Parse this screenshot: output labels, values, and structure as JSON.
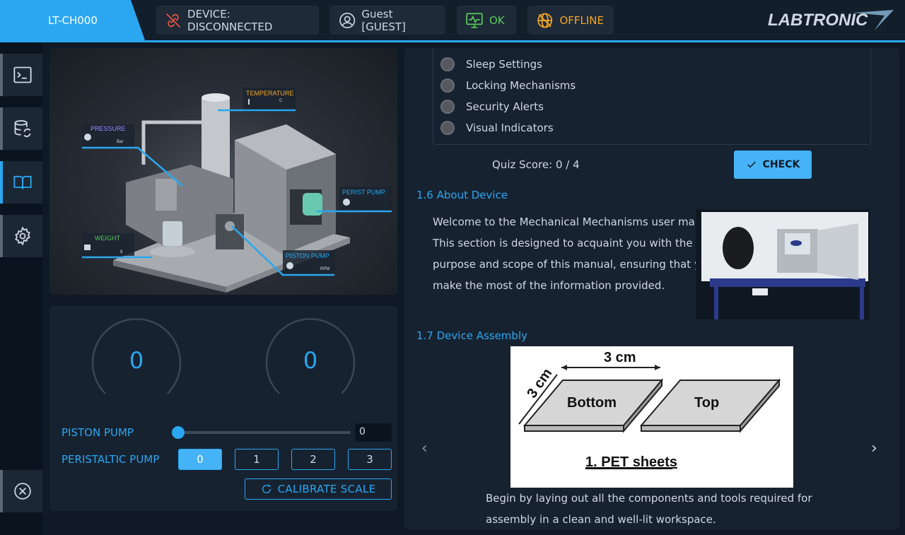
{
  "header": {
    "device_tab": "LT-CH000",
    "device_status": "DEVICE: DISCONNECTED",
    "user": "Guest [GUEST]",
    "health": "OK",
    "network": "OFFLINE",
    "logo": "LABTRONIC",
    "colors": {
      "accent": "#2aa7f0",
      "danger": "#e25545",
      "ok": "#5ac85a",
      "offline": "#f5a623"
    }
  },
  "sidebar": {
    "items": [
      {
        "icon": "terminal-icon"
      },
      {
        "icon": "database-sync-icon"
      },
      {
        "icon": "book-icon",
        "active": true
      },
      {
        "icon": "gear-icon"
      }
    ],
    "bottom": {
      "icon": "close-circle-icon"
    }
  },
  "diagram": {
    "labels": {
      "temperature": "TEMPERATURE",
      "temperature_unit": "C",
      "pressure": "PRESSURE",
      "pressure_unit": "Bar",
      "perist_pump": "PERIST PUMP",
      "weight": "WEIGHT",
      "weight_unit": "g",
      "piston_pump": "PISTON PUMP",
      "piston_unit": "RPM"
    }
  },
  "controls": {
    "gauge1": "0",
    "gauge2": "0",
    "piston_label": "PISTON PUMP",
    "piston_value": "0",
    "peristaltic_label": "PERISTALTIC PUMP",
    "peristaltic_options": [
      "0",
      "1",
      "2",
      "3"
    ],
    "peristaltic_selected": "0",
    "calibrate": "CALIBRATE SCALE"
  },
  "manual": {
    "quiz_options": [
      "Sleep Settings",
      "Locking Mechanisms",
      "Security Alerts",
      "Visual Indicators"
    ],
    "quiz_score": "Quiz Score: 0 / 4",
    "check_label": "CHECK",
    "about_title": "1.6 About Device",
    "about_lines": [
      "Welcome to the Mechanical Mechanisms user manual.",
      "This section is designed to acquaint you with the",
      "purpose and scope of this manual, ensuring that you",
      "make the most of the information provided."
    ],
    "assembly_title": "1.7 Device Assembly",
    "assembly_image": {
      "dim_top": "3 cm",
      "dim_side": "3 cm",
      "left": "Bottom",
      "right": "Top",
      "caption": "1. PET sheets"
    },
    "assembly_lines": [
      "Begin by laying out all the components and tools required for",
      "assembly in a clean and well-lit workspace."
    ]
  }
}
